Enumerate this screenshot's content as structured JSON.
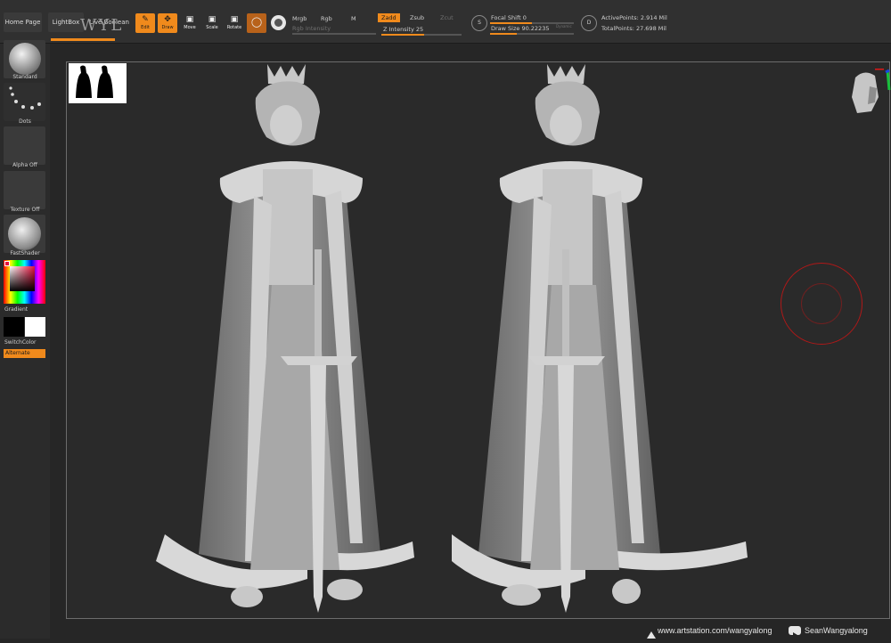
{
  "header": {
    "tabs": [
      {
        "label": "Home Page"
      },
      {
        "label": "LightBox"
      },
      {
        "label": "Live Boolean"
      }
    ],
    "tools": [
      {
        "label": "Edit",
        "active": true
      },
      {
        "label": "Draw",
        "active": true
      },
      {
        "label": "Move",
        "active": false
      },
      {
        "label": "Scale",
        "active": false
      },
      {
        "label": "Rotate",
        "active": false
      }
    ],
    "color_modes": {
      "mrgb": "Mrgb",
      "rgb": "Rgb",
      "m": "M",
      "rgb_intensity_label": "Rgb Intensity"
    },
    "z_modes": {
      "zadd": "Zadd",
      "zsub": "Zsub",
      "zcut": "Zcut",
      "z_intensity_label": "Z Intensity 25",
      "z_intensity": 25
    },
    "focal": {
      "focal_shift_label": "Focal Shift 0",
      "focal_shift": 0,
      "draw_size_label": "Draw Size 90.22235",
      "dynamic_label": "Dynamic"
    },
    "points": {
      "active_label": "ActivePoints: 2.914 Mil",
      "total_label": "TotalPoints: 27.698 Mil"
    },
    "overlay_text": "WYL"
  },
  "left_panel": {
    "brush_label": "Standard",
    "stroke_label": "Dots",
    "alpha_label": "Alpha Off",
    "texture_label": "Texture Off",
    "material_label": "FastShader",
    "gradient_label": "Gradient",
    "switch_color_label": "SwitchColor",
    "alternate_label": "Alternate"
  },
  "footer": {
    "artstation": "www.artstation.com/wangyalong",
    "youtube": "SeanWangyalong"
  },
  "colors": {
    "accent": "#f08a1c",
    "background": "#262626",
    "panel": "#303030"
  }
}
